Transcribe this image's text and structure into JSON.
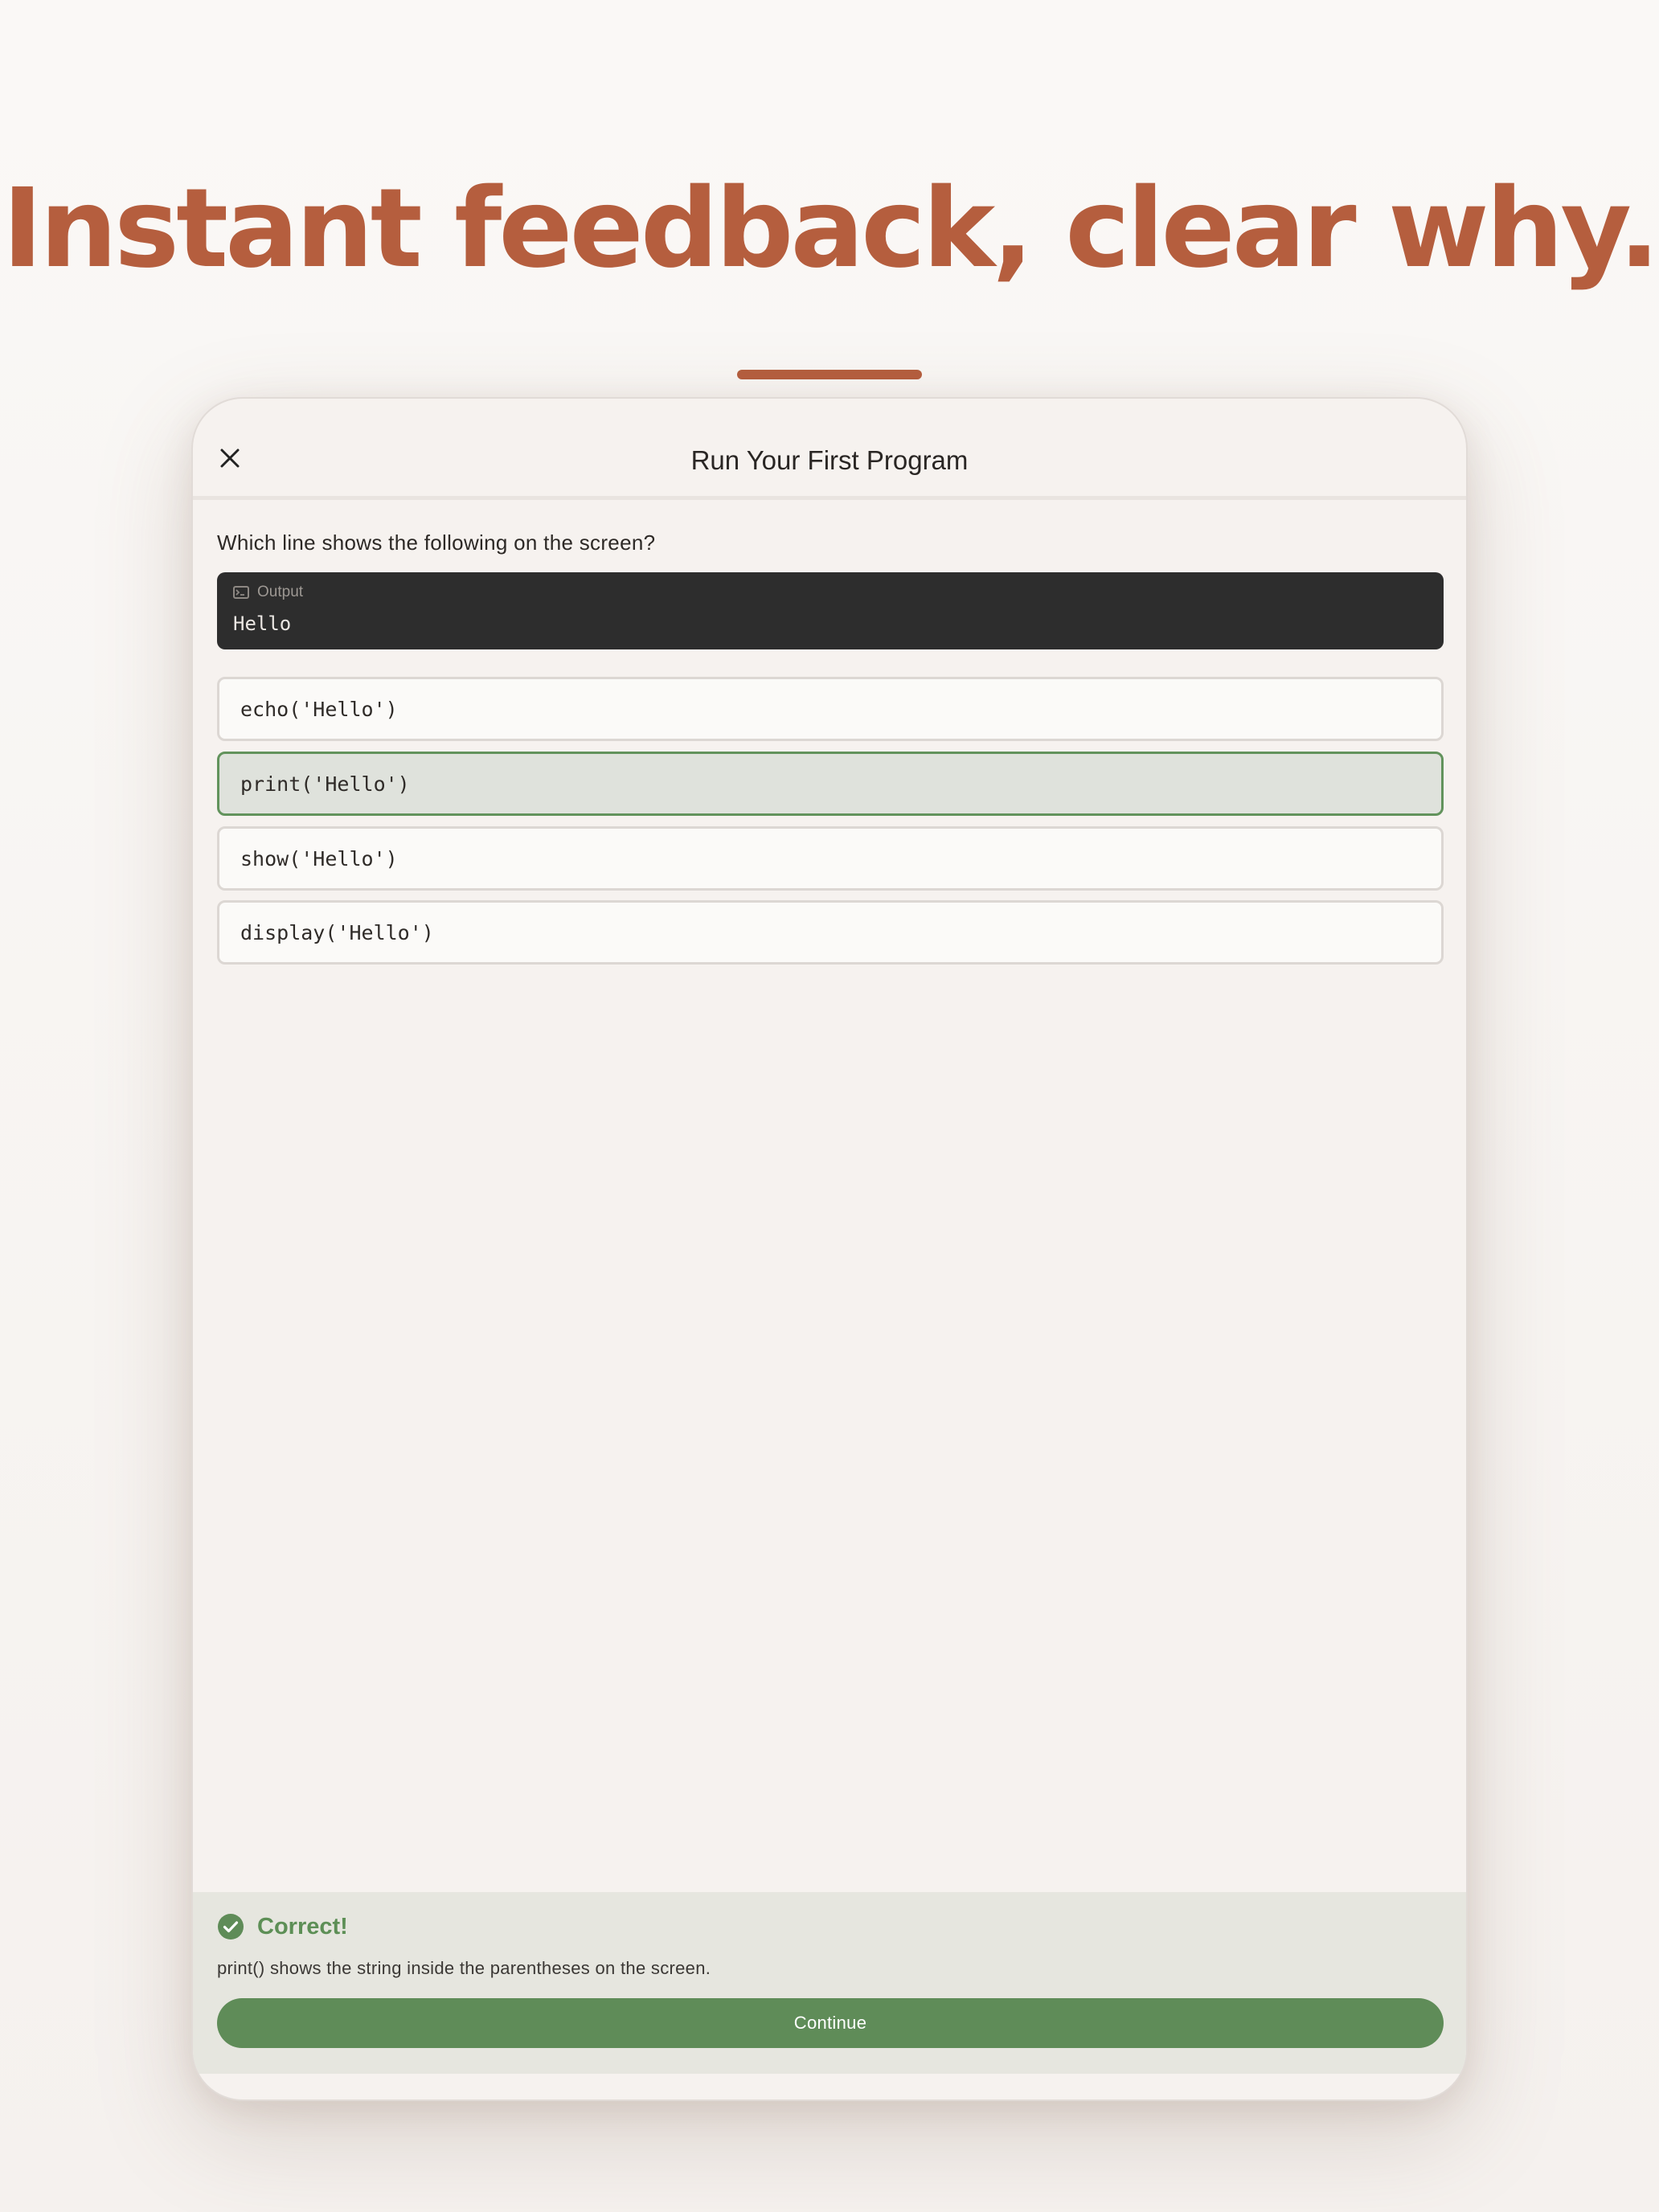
{
  "headline": "Instant feedback, clear why.",
  "colors": {
    "accent": "#b55e3e",
    "success": "#5f8c58",
    "output_bg": "#2d2d2d"
  },
  "lesson": {
    "title": "Run Your First Program",
    "close_icon": "close-icon",
    "question": "Which line shows the following on the screen?",
    "output": {
      "label": "Output",
      "icon": "terminal-icon",
      "text": "Hello"
    },
    "options": [
      {
        "label": "echo('Hello')",
        "state": "default"
      },
      {
        "label": "print('Hello')",
        "state": "correct"
      },
      {
        "label": "show('Hello')",
        "state": "default"
      },
      {
        "label": "display('Hello')",
        "state": "default"
      }
    ]
  },
  "feedback": {
    "icon": "check-circle-icon",
    "title": "Correct!",
    "explanation": "print() shows the string inside the parentheses on the screen.",
    "continue_label": "Continue"
  }
}
